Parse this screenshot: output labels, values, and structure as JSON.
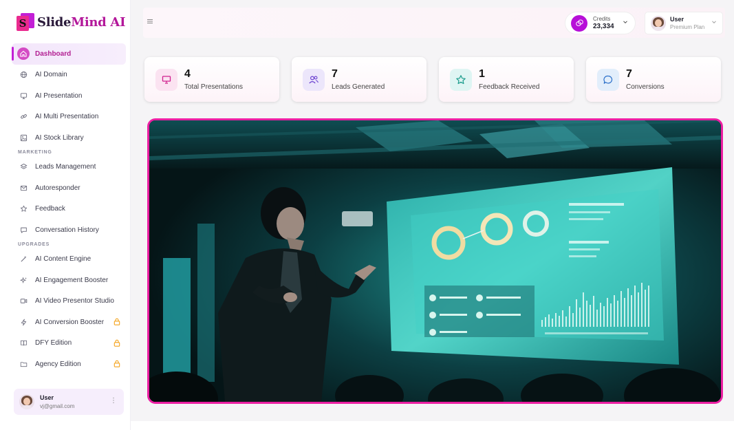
{
  "brand": {
    "name_part1": "Slide",
    "name_part2": "Mind AI",
    "mark_letter": "S"
  },
  "sidebar": {
    "items": [
      {
        "label": "Dashboard",
        "icon": "home-icon",
        "active": true
      },
      {
        "label": "AI Domain",
        "icon": "globe-icon"
      },
      {
        "label": "AI Presentation",
        "icon": "monitor-icon"
      },
      {
        "label": "AI Multi Presentation",
        "icon": "link-icon"
      },
      {
        "label": "AI Stock Library",
        "icon": "image-icon"
      }
    ],
    "marketing_label": "MARKETING",
    "marketing": [
      {
        "label": "Leads Management",
        "icon": "layers-icon"
      },
      {
        "label": "Autoresponder",
        "icon": "mail-icon"
      },
      {
        "label": "Feedback",
        "icon": "star-icon"
      },
      {
        "label": "Conversation History",
        "icon": "chat-icon"
      }
    ],
    "upgrades_label": "UPGRADES",
    "upgrades": [
      {
        "label": "AI Content Engine",
        "icon": "wand-icon",
        "locked": false
      },
      {
        "label": "AI Engagement Booster",
        "icon": "sparkle-icon",
        "locked": false
      },
      {
        "label": "AI Video Presentor Studio",
        "icon": "video-icon",
        "locked": false
      },
      {
        "label": "AI Conversion Booster",
        "icon": "bolt-icon",
        "locked": true
      },
      {
        "label": "DFY Edition",
        "icon": "book-icon",
        "locked": true
      },
      {
        "label": "Agency Edition",
        "icon": "folder-icon",
        "locked": true
      }
    ]
  },
  "user_card": {
    "name": "User",
    "email": "vj@gmail.com"
  },
  "header": {
    "credits_label": "Credits",
    "credits_value": "23,334",
    "user_name": "User",
    "user_plan": "Premium Plan"
  },
  "stats": [
    {
      "value": "4",
      "label": "Total Presentations",
      "icon": "presentation-icon",
      "bg": "#fbe3f1",
      "color": "#d0208e"
    },
    {
      "value": "7",
      "label": "Leads Generated",
      "icon": "users-icon",
      "bg": "#ece6fb",
      "color": "#6a3fd0"
    },
    {
      "value": "1",
      "label": "Feedback Received",
      "icon": "star-icon",
      "bg": "#dff5f3",
      "color": "#1b9c8c"
    },
    {
      "value": "7",
      "label": "Conversions",
      "icon": "chat-icon",
      "bg": "#e2eefb",
      "color": "#2a6fc9"
    }
  ]
}
